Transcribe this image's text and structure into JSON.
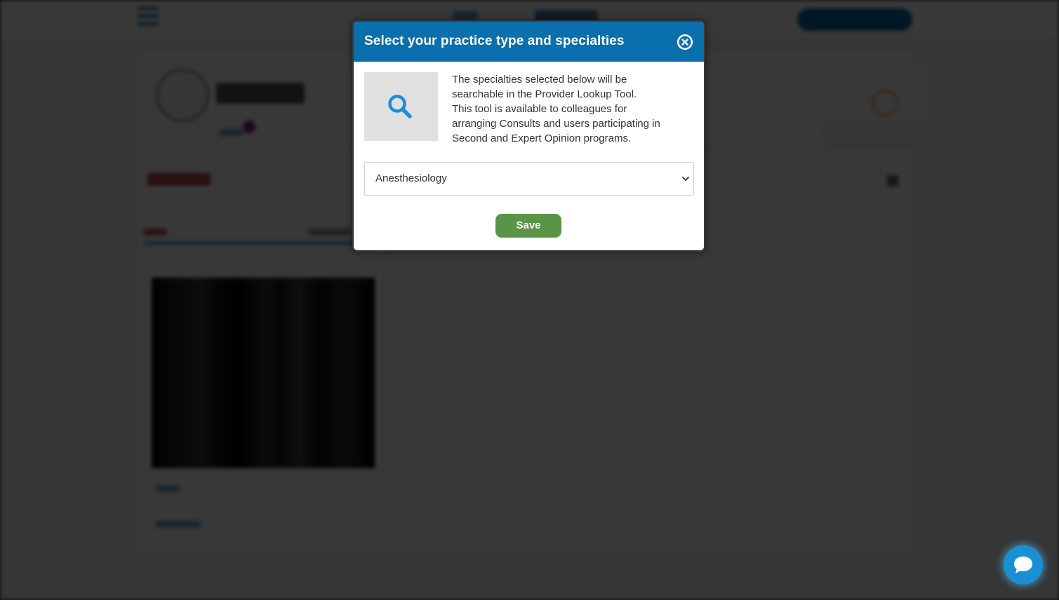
{
  "modal": {
    "title": "Select your practice type and specialties",
    "description_lines": [
      "The specialties selected below will be",
      "searchable in the Provider Lookup Tool.",
      "This tool is available to colleagues for",
      "arranging Consults and users participating in",
      "Second and Expert Opinion programs."
    ],
    "specialty_select": {
      "selected": "Anesthesiology"
    },
    "save_label": "Save",
    "close_icon": "close-circle-icon",
    "search_icon": "magnifier-icon"
  },
  "chat": {
    "icon": "chat-bubble-icon"
  },
  "colors": {
    "header": "#0a6fad",
    "save_button": "#5a9447",
    "search_icon": "#1a8fd8",
    "chat_button": "#1b8fd4"
  }
}
